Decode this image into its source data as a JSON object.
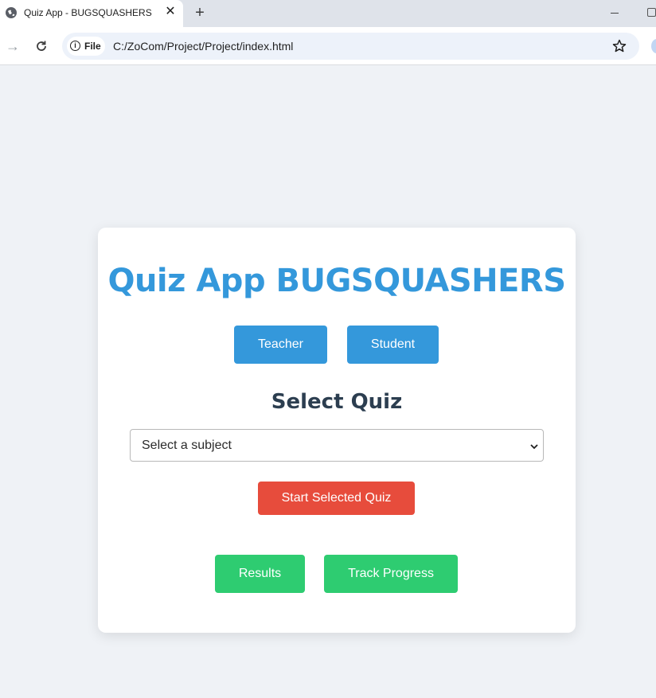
{
  "browser": {
    "tab_title": "Quiz App - BUGSQUASHERS",
    "tab_close": "✕",
    "new_tab": "+",
    "site_chip_label": "File",
    "url": "C:/ZoCom/Project/Project/index.html"
  },
  "app": {
    "title": "Quiz App BUGSQUASHERS",
    "role_buttons": {
      "teacher_label": "Teacher",
      "student_label": "Student"
    },
    "select_quiz": {
      "heading": "Select Quiz",
      "selected_value": "Select a subject"
    },
    "start_button_label": "Start Selected Quiz",
    "results_button_label": "Results",
    "track_progress_button_label": "Track Progress"
  },
  "colors": {
    "primary_blue": "#3498db",
    "danger_red": "#e74c3c",
    "success_green": "#2ecc71",
    "heading_dark": "#2c3e50",
    "page_background": "#eff2f6"
  },
  "icons": [
    "globe-icon",
    "close-icon",
    "plus-icon",
    "minimize-icon",
    "maximize-icon",
    "forward-arrow-icon",
    "reload-icon",
    "info-icon",
    "star-icon",
    "chevron-down-icon"
  ]
}
